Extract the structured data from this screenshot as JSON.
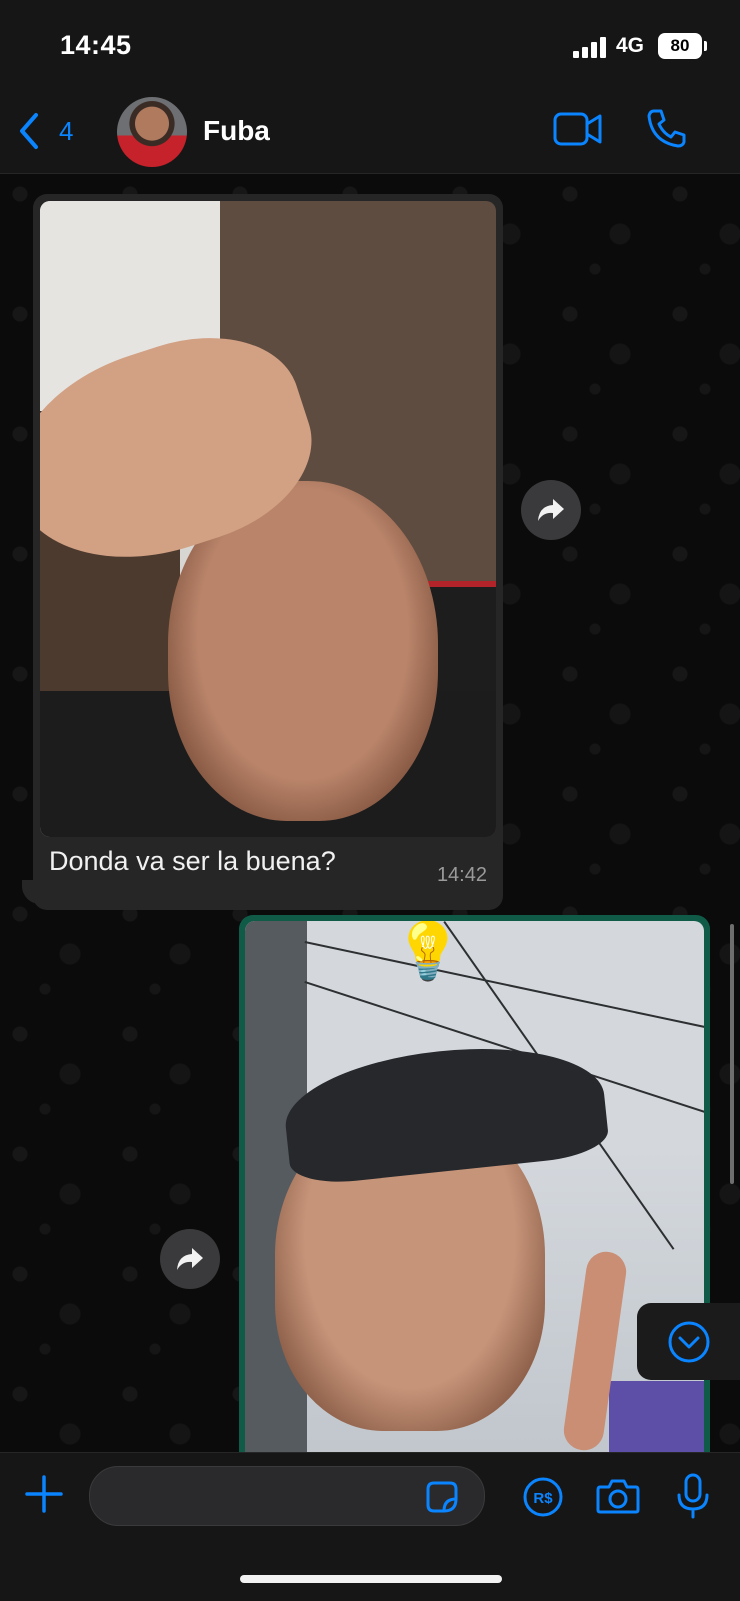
{
  "status_bar": {
    "time": "14:45",
    "network": "4G",
    "battery": "80"
  },
  "header": {
    "back_count": "4",
    "contact_name": "Fuba"
  },
  "messages": [
    {
      "direction": "incoming",
      "type": "image",
      "caption": "Donda va ser la buena?",
      "time": "14:42"
    },
    {
      "direction": "outgoing",
      "type": "image",
      "sticker": "💡"
    }
  ],
  "input": {
    "placeholder": "",
    "value": ""
  },
  "icons": {
    "back": "chevron-left-icon",
    "video": "video-camera-icon",
    "call": "phone-icon",
    "forward": "forward-arrow-icon",
    "scroll_down": "chevron-down-circle-icon",
    "attach": "plus-icon",
    "sticker": "sticker-icon",
    "payment": "real-currency-icon",
    "camera": "camera-icon",
    "mic": "microphone-icon"
  },
  "colors": {
    "accent": "#0a84ff",
    "outgoing_bubble": "#0f5b48",
    "incoming_bubble": "#262626"
  }
}
